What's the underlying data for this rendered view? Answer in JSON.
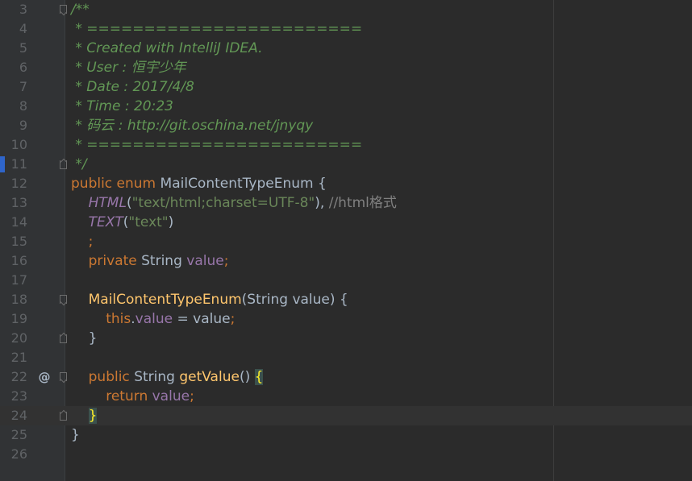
{
  "editor": {
    "colors": {
      "background": "#2b2b2b",
      "gutter": "#313335",
      "line_number": "#606366",
      "doc_comment": "#629755",
      "keyword": "#cc7832",
      "string": "#6a8759",
      "field": "#9876aa",
      "method": "#ffc66d",
      "plain": "#a9b7c6"
    },
    "current_line": 24,
    "lines": [
      {
        "n": "3",
        "fold": "start",
        "icon": "",
        "tokens": [
          {
            "c": "doc",
            "t": "/**"
          }
        ]
      },
      {
        "n": "4",
        "fold": "",
        "icon": "",
        "tokens": [
          {
            "c": "doc",
            "t": " * ========================"
          }
        ]
      },
      {
        "n": "5",
        "fold": "",
        "icon": "",
        "tokens": [
          {
            "c": "doc",
            "t": " * Created with IntelliJ IDEA."
          }
        ]
      },
      {
        "n": "6",
        "fold": "",
        "icon": "",
        "tokens": [
          {
            "c": "doc",
            "t": " * User : 恒宇少年"
          }
        ]
      },
      {
        "n": "7",
        "fold": "",
        "icon": "",
        "tokens": [
          {
            "c": "doc",
            "t": " * Date : 2017/4/8"
          }
        ]
      },
      {
        "n": "8",
        "fold": "",
        "icon": "",
        "tokens": [
          {
            "c": "doc",
            "t": " * Time : 20:23"
          }
        ]
      },
      {
        "n": "9",
        "fold": "",
        "icon": "",
        "tokens": [
          {
            "c": "doc",
            "t": " * 码云 : http://git.oschina.net/jnyqy"
          }
        ]
      },
      {
        "n": "10",
        "fold": "",
        "icon": "",
        "tokens": [
          {
            "c": "doc",
            "t": " * ========================"
          }
        ]
      },
      {
        "n": "11",
        "fold": "end",
        "icon": "",
        "tokens": [
          {
            "c": "doc",
            "t": " */"
          }
        ]
      },
      {
        "n": "12",
        "fold": "",
        "icon": "",
        "tokens": [
          {
            "c": "kw",
            "t": "public enum "
          },
          {
            "c": "plain",
            "t": "MailContentTypeEnum {"
          }
        ]
      },
      {
        "n": "13",
        "fold": "",
        "icon": "",
        "tokens": [
          {
            "c": "plain",
            "t": "    "
          },
          {
            "c": "const",
            "t": "HTML"
          },
          {
            "c": "plain",
            "t": "("
          },
          {
            "c": "str",
            "t": "\"text/html;charset=UTF-8\""
          },
          {
            "c": "plain",
            "t": "), "
          },
          {
            "c": "comment",
            "t": "//html格式"
          }
        ]
      },
      {
        "n": "14",
        "fold": "",
        "icon": "",
        "tokens": [
          {
            "c": "plain",
            "t": "    "
          },
          {
            "c": "const",
            "t": "TEXT"
          },
          {
            "c": "plain",
            "t": "("
          },
          {
            "c": "str",
            "t": "\"text\""
          },
          {
            "c": "plain",
            "t": ")"
          }
        ]
      },
      {
        "n": "15",
        "fold": "",
        "icon": "",
        "tokens": [
          {
            "c": "plain",
            "t": "    "
          },
          {
            "c": "kw",
            "t": ";"
          }
        ]
      },
      {
        "n": "16",
        "fold": "",
        "icon": "",
        "tokens": [
          {
            "c": "plain",
            "t": "    "
          },
          {
            "c": "kw",
            "t": "private "
          },
          {
            "c": "plain",
            "t": "String "
          },
          {
            "c": "field",
            "t": "value"
          },
          {
            "c": "kw",
            "t": ";"
          }
        ]
      },
      {
        "n": "17",
        "fold": "",
        "icon": "",
        "tokens": []
      },
      {
        "n": "18",
        "fold": "start",
        "icon": "",
        "tokens": [
          {
            "c": "plain",
            "t": "    "
          },
          {
            "c": "method",
            "t": "MailContentTypeEnum"
          },
          {
            "c": "plain",
            "t": "(String value) {"
          }
        ]
      },
      {
        "n": "19",
        "fold": "",
        "icon": "",
        "tokens": [
          {
            "c": "plain",
            "t": "        "
          },
          {
            "c": "kw",
            "t": "this"
          },
          {
            "c": "plain",
            "t": "."
          },
          {
            "c": "field",
            "t": "value"
          },
          {
            "c": "plain",
            "t": " = value"
          },
          {
            "c": "kw",
            "t": ";"
          }
        ]
      },
      {
        "n": "20",
        "fold": "end",
        "icon": "",
        "tokens": [
          {
            "c": "plain",
            "t": "    }"
          }
        ]
      },
      {
        "n": "21",
        "fold": "",
        "icon": "",
        "tokens": []
      },
      {
        "n": "22",
        "fold": "start",
        "icon": "@",
        "tokens": [
          {
            "c": "plain",
            "t": "    "
          },
          {
            "c": "kw",
            "t": "public "
          },
          {
            "c": "plain",
            "t": "String "
          },
          {
            "c": "method",
            "t": "getValue"
          },
          {
            "c": "plain",
            "t": "() "
          },
          {
            "c": "brace",
            "t": "{"
          }
        ]
      },
      {
        "n": "23",
        "fold": "",
        "icon": "",
        "tokens": [
          {
            "c": "plain",
            "t": "        "
          },
          {
            "c": "kw",
            "t": "return "
          },
          {
            "c": "field",
            "t": "value"
          },
          {
            "c": "kw",
            "t": ";"
          }
        ]
      },
      {
        "n": "24",
        "fold": "end",
        "icon": "",
        "tokens": [
          {
            "c": "plain",
            "t": "    "
          },
          {
            "c": "brace",
            "t": "}"
          }
        ]
      },
      {
        "n": "25",
        "fold": "",
        "icon": "",
        "tokens": [
          {
            "c": "plain",
            "t": "}"
          }
        ]
      },
      {
        "n": "26",
        "fold": "",
        "icon": "",
        "tokens": []
      }
    ]
  }
}
